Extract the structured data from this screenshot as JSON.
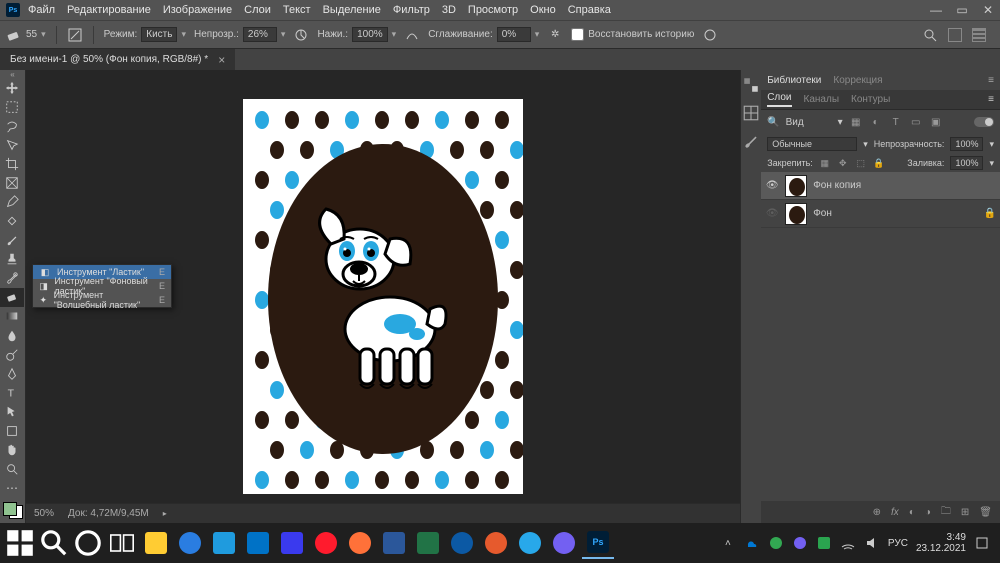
{
  "app": {
    "name": "Ps"
  },
  "menu": {
    "items": [
      "Файл",
      "Редактирование",
      "Изображение",
      "Слои",
      "Текст",
      "Выделение",
      "Фильтр",
      "3D",
      "Просмотр",
      "Окно",
      "Справка"
    ]
  },
  "window_controls": {
    "minimize": "—",
    "restore": "▭",
    "close": "✕"
  },
  "options": {
    "brush_size": "55",
    "mode_label": "Режим:",
    "mode_value": "Кисть",
    "opacity_label": "Непрозр.:",
    "opacity_value": "26%",
    "flow_label": "Нажи.:",
    "flow_value": "100%",
    "smoothing_label": "Сглаживание:",
    "smoothing_value": "0%",
    "restore_history": "Восстановить историю"
  },
  "doc_tab": {
    "title": "Без имени-1 @ 50% (Фон копия, RGB/8#) *",
    "close": "×"
  },
  "tool_flyout": {
    "items": [
      {
        "label": "Инструмент \"Ластик\"",
        "key": "E"
      },
      {
        "label": "Инструмент \"Фоновый ластик\"",
        "key": "E"
      },
      {
        "label": "Инструмент \"Волшебный ластик\"",
        "key": "E"
      }
    ]
  },
  "panels": {
    "top_tabs": {
      "libraries": "Библиотеки",
      "corrections": "Коррекция"
    },
    "sub_tabs": {
      "layers": "Слои",
      "channels": "Каналы",
      "paths": "Контуры"
    },
    "filter_kind": "Вид",
    "blend_mode": "Обычные",
    "opacity_label": "Непрозрачность:",
    "opacity_value": "100%",
    "lock_label": "Закрепить:",
    "fill_label": "Заливка:",
    "fill_value": "100%",
    "layers": [
      {
        "name": "Фон копия",
        "visible": true,
        "locked": false,
        "active": true
      },
      {
        "name": "Фон",
        "visible": false,
        "locked": true,
        "active": false
      }
    ],
    "bottom_icons": [
      "⊕",
      "fx",
      "◐",
      "▣",
      "□",
      "⊞",
      "🗑"
    ]
  },
  "status": {
    "zoom": "50%",
    "doc_size": "Док: 4,72M/9,45M"
  },
  "taskbar": {
    "tray": {
      "lang": "РУС",
      "time": "3:49",
      "date": "23.12.2021"
    }
  }
}
